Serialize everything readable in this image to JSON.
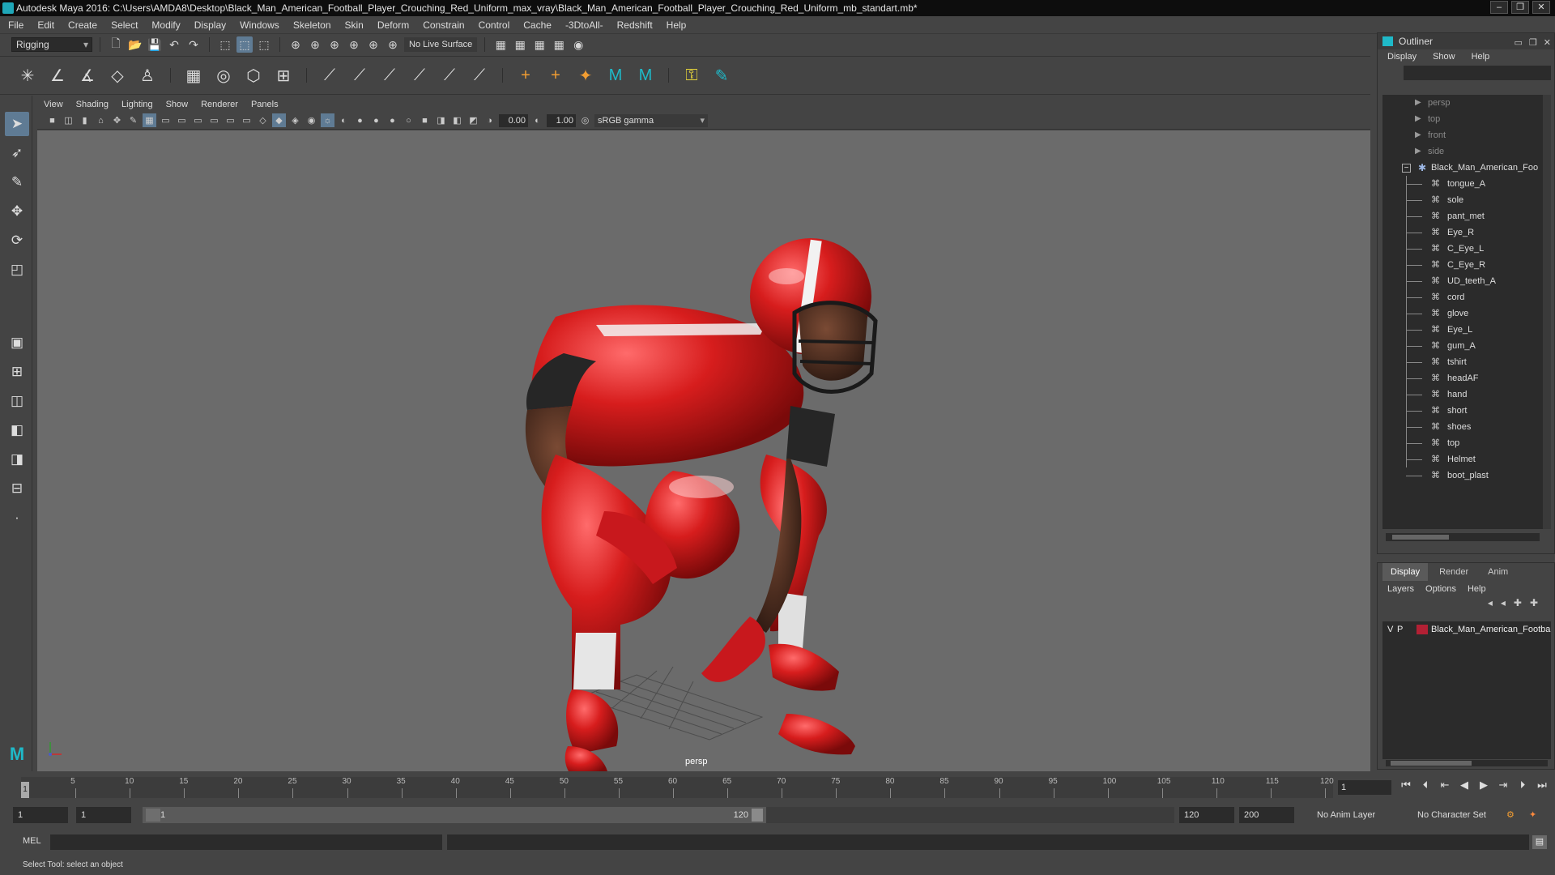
{
  "window": {
    "title": "Autodesk Maya 2016: C:\\Users\\AMDA8\\Desktop\\Black_Man_American_Football_Player_Crouching_Red_Uniform_max_vray\\Black_Man_American_Football_Player_Crouching_Red_Uniform_mb_standart.mb*",
    "controls": [
      "–",
      "❐",
      "✕"
    ]
  },
  "menubar": [
    "File",
    "Edit",
    "Create",
    "Select",
    "Modify",
    "Display",
    "Windows",
    "Skeleton",
    "Skin",
    "Deform",
    "Constrain",
    "Control",
    "Cache",
    "-3DtoAll-",
    "Redshift",
    "Help"
  ],
  "statusline": {
    "mode": "Rigging",
    "live_surface": "No Live Surface"
  },
  "panel": {
    "menus": [
      "View",
      "Shading",
      "Lighting",
      "Show",
      "Renderer",
      "Panels"
    ],
    "near_clip": "0.00",
    "gamma_value": "1.00",
    "color_space": "sRGB gamma",
    "camera": "persp"
  },
  "outliner": {
    "title": "Outliner",
    "menus": [
      "Display",
      "Show",
      "Help"
    ],
    "cameras": [
      "persp",
      "top",
      "front",
      "side"
    ],
    "group": "Black_Man_American_Foo",
    "children": [
      "tongue_A",
      "sole",
      "pant_met",
      "Eye_R",
      "C_Eye_L",
      "C_Eye_R",
      "UD_teeth_A",
      "cord",
      "glove",
      "Eye_L",
      "gum_A",
      "tshirt",
      "headAF",
      "hand",
      "short",
      "shoes",
      "top",
      "Helmet",
      "boot_plast"
    ]
  },
  "layer_editor": {
    "tabs": [
      "Display",
      "Render",
      "Anim"
    ],
    "menus": [
      "Layers",
      "Options",
      "Help"
    ],
    "layer": {
      "v": "V",
      "p": "P",
      "name": "Black_Man_American_Footba",
      "color": "#b22034"
    }
  },
  "timeline": {
    "ticks": [
      "5",
      "10",
      "15",
      "20",
      "25",
      "30",
      "35",
      "40",
      "45",
      "50",
      "55",
      "60",
      "65",
      "70",
      "75",
      "80",
      "85",
      "90",
      "95",
      "100",
      "105",
      "110",
      "115",
      "120"
    ],
    "current_marker": "1",
    "current_frame": "1"
  },
  "range": {
    "start": "1",
    "playback_start": "1",
    "slider_start": "1",
    "slider_end": "120",
    "playback_end": "120",
    "end": "200",
    "anim_layer": "No Anim Layer",
    "character_set": "No Character Set"
  },
  "commandline": {
    "label": "MEL"
  },
  "helpline": {
    "text": "Select Tool: select an object"
  }
}
